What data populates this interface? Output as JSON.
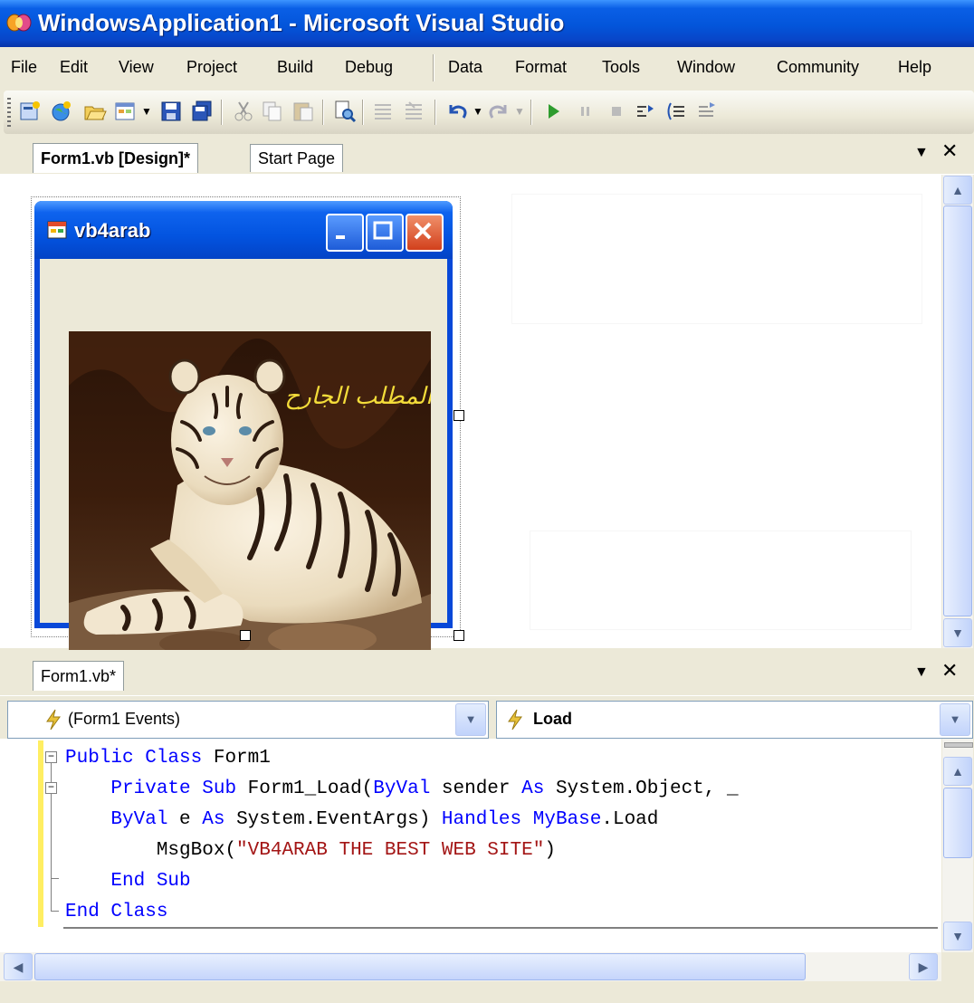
{
  "window": {
    "title": "WindowsApplication1 - Microsoft Visual Studio"
  },
  "menu": [
    "File",
    "Edit",
    "View",
    "Project",
    "Build",
    "Debug",
    "Data",
    "Format",
    "Tools",
    "Window",
    "Community",
    "Help"
  ],
  "toolbar": {
    "icons": [
      "new-project-icon",
      "add-web-site-icon",
      "open-file-icon",
      "add-item-icon",
      "save-icon",
      "save-all-icon",
      "cut-icon",
      "copy-icon",
      "paste-icon",
      "find-icon",
      "comment-icon",
      "uncomment-icon",
      "undo-icon",
      "redo-icon",
      "start-debugging-icon",
      "break-all-icon",
      "stop-debugging-icon",
      "step-into-icon",
      "step-over-icon",
      "step-out-icon"
    ]
  },
  "designer": {
    "tabs": [
      {
        "label": "Form1.vb [Design]*",
        "active": true
      },
      {
        "label": "Start Page",
        "active": false
      }
    ],
    "form": {
      "title": "vb4arab",
      "image_caption_arabic": "المطلب الجارح"
    }
  },
  "code": {
    "tab_label": "Form1.vb*",
    "class_combo": "(Form1 Events)",
    "method_combo": "Load",
    "lines": [
      {
        "indent": "",
        "parts": [
          {
            "t": "Public Class",
            "k": "kw"
          },
          {
            "t": " Form1",
            "k": ""
          }
        ]
      },
      {
        "indent": "    ",
        "parts": [
          {
            "t": "Private Sub",
            "k": "kw"
          },
          {
            "t": " Form1_Load(",
            "k": ""
          },
          {
            "t": "ByVal",
            "k": "kw"
          },
          {
            "t": " sender ",
            "k": ""
          },
          {
            "t": "As",
            "k": "kw"
          },
          {
            "t": " System.Object, _",
            "k": ""
          }
        ]
      },
      {
        "indent": "    ",
        "parts": [
          {
            "t": "ByVal",
            "k": "kw"
          },
          {
            "t": " e ",
            "k": ""
          },
          {
            "t": "As",
            "k": "kw"
          },
          {
            "t": " System.EventArgs) ",
            "k": ""
          },
          {
            "t": "Handles",
            "k": "kw"
          },
          {
            "t": " ",
            "k": ""
          },
          {
            "t": "MyBase",
            "k": "kw"
          },
          {
            "t": ".Load",
            "k": ""
          }
        ]
      },
      {
        "indent": "        ",
        "parts": [
          {
            "t": "MsgBox(",
            "k": ""
          },
          {
            "t": "\"VB4ARAB THE BEST WEB SITE\"",
            "k": "str"
          },
          {
            "t": ")",
            "k": ""
          }
        ]
      },
      {
        "indent": "    ",
        "parts": [
          {
            "t": "End Sub",
            "k": "kw"
          }
        ]
      },
      {
        "indent": "",
        "parts": [
          {
            "t": "End Class",
            "k": "kw"
          }
        ]
      }
    ]
  },
  "colors": {
    "keyword": "#0000ff",
    "string": "#a31515",
    "xp_title": "#0355da",
    "chrome": "#ece9d8"
  }
}
